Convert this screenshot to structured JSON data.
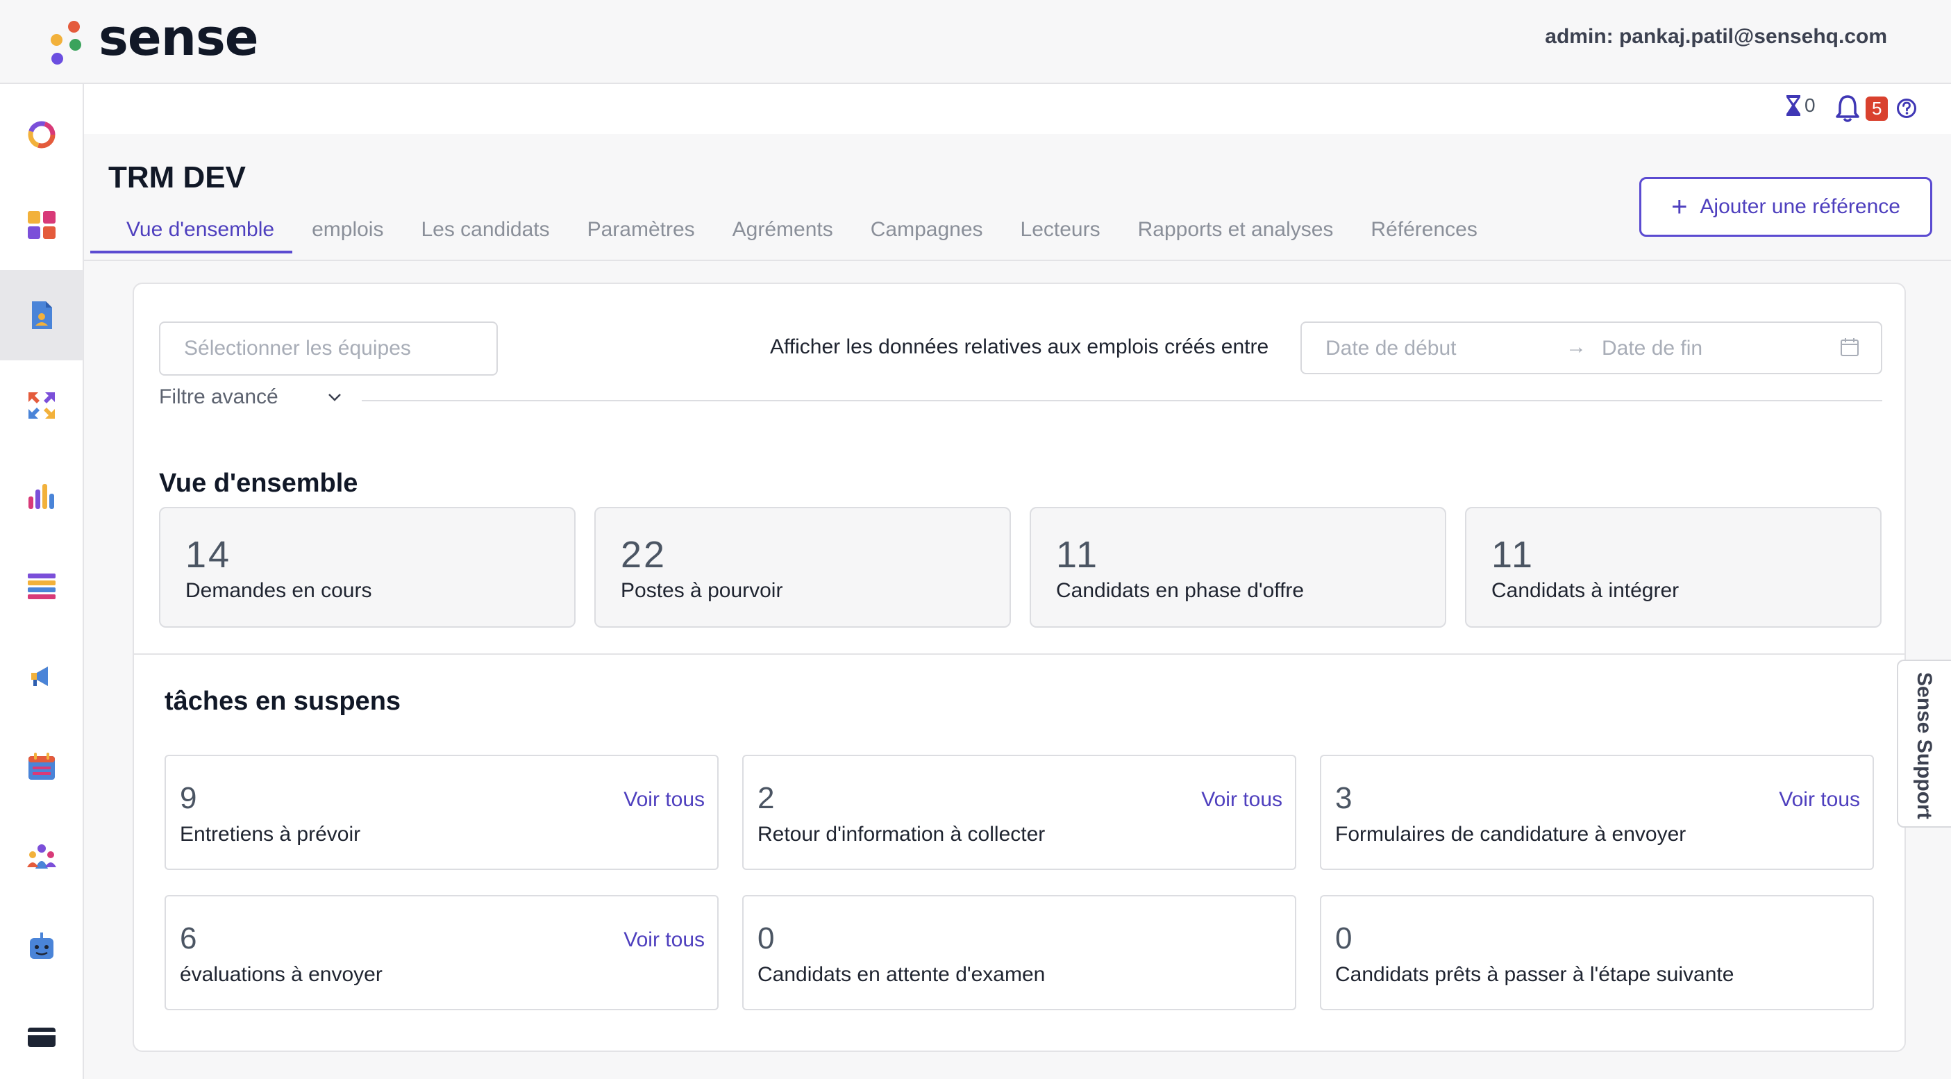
{
  "brand": {
    "name": "sense"
  },
  "header": {
    "admin": "admin: pankaj.patil@sensehq.com"
  },
  "utility": {
    "pending_count": "0",
    "notification_count": "5"
  },
  "page": {
    "title": "TRM DEV",
    "add_reference_label": "Ajouter une référence"
  },
  "tabs": [
    {
      "label": "Vue d'ensemble"
    },
    {
      "label": "emplois"
    },
    {
      "label": "Les candidats"
    },
    {
      "label": "Paramètres"
    },
    {
      "label": "Agréments"
    },
    {
      "label": "Campagnes"
    },
    {
      "label": "Lecteurs"
    },
    {
      "label": "Rapports et analyses"
    },
    {
      "label": "Références"
    }
  ],
  "filters": {
    "team_placeholder": "Sélectionner les équipes",
    "range_label": "Afficher les données relatives aux emplois créés entre",
    "start_placeholder": "Date de début",
    "end_placeholder": "Date de fin",
    "advanced_label": "Filtre avancé"
  },
  "overview": {
    "title": "Vue d'ensemble",
    "stats": [
      {
        "value": "14",
        "label": "Demandes en cours"
      },
      {
        "value": "22",
        "label": "Postes à pourvoir"
      },
      {
        "value": "11",
        "label": "Candidats en phase d'offre"
      },
      {
        "value": "11",
        "label": "Candidats à intégrer"
      }
    ]
  },
  "tasks": {
    "title": "tâches en suspens",
    "link_label": "Voir tous",
    "items": [
      {
        "value": "9",
        "label": "Entretiens à prévoir"
      },
      {
        "value": "2",
        "label": "Retour d'information à collecter"
      },
      {
        "value": "3",
        "label": "Formulaires de candidature à envoyer"
      },
      {
        "value": "6",
        "label": "évaluations à envoyer"
      },
      {
        "value": "0",
        "label": "Candidats en attente d'examen"
      },
      {
        "value": "0",
        "label": "Candidats prêts à passer à l'étape suivante"
      }
    ]
  },
  "support": {
    "label": "Sense Support"
  },
  "icons": {
    "logo": "sense-logo-dots",
    "sidebar": [
      "donut-chart-icon",
      "grid-icon",
      "document-user-icon",
      "arrows-icon",
      "bar-chart-icon",
      "list-icon",
      "megaphone-icon",
      "calendar-icon",
      "people-icon",
      "chatbot-icon",
      "card-icon"
    ],
    "utility": [
      "hourglass-icon",
      "bell-icon",
      "help-icon"
    ]
  },
  "colors": {
    "accent": "#5b4bd1",
    "badge": "#d9412e"
  }
}
